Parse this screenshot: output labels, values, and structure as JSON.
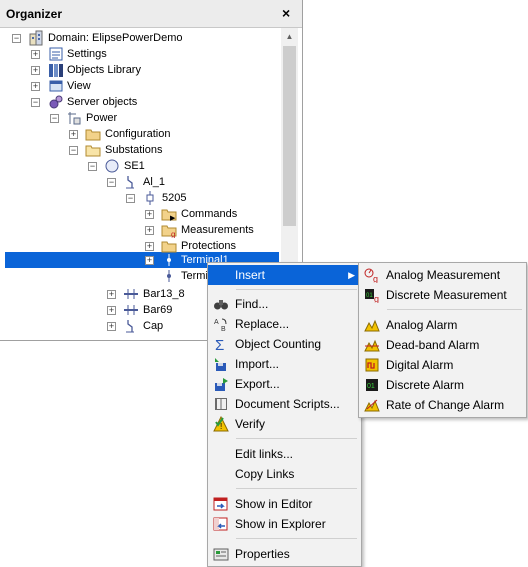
{
  "organizer": {
    "title": "Organizer",
    "close": "×",
    "scroll_up": "▲"
  },
  "tree": {
    "domain": "Domain: ElipsePowerDemo",
    "settings": "Settings",
    "objects_library": "Objects Library",
    "view": "View",
    "server_objects": "Server objects",
    "power": "Power",
    "configuration": "Configuration",
    "substations": "Substations",
    "se1": "SE1",
    "al1": "Al_1",
    "n5205": "5205",
    "commands": "Commands",
    "measurements": "Measurements",
    "protections": "Protections",
    "terminal1": "Terminal1",
    "terminal_partial": "Termi",
    "bar13": "Bar13_8",
    "bar69": "Bar69",
    "cap": "Cap"
  },
  "menu": {
    "insert": "Insert",
    "find": "Find...",
    "replace": "Replace...",
    "object_counting": "Object Counting",
    "import": "Import...",
    "export": "Export...",
    "document_scripts": "Document Scripts...",
    "verify": "Verify",
    "edit_links": "Edit links...",
    "copy_links": "Copy Links",
    "show_in_editor": "Show in Editor",
    "show_in_explorer": "Show in Explorer",
    "properties": "Properties",
    "submenu_arrow": "▶"
  },
  "submenu": {
    "analog_measurement": "Analog Measurement",
    "discrete_measurement": "Discrete Measurement",
    "analog_alarm": "Analog Alarm",
    "deadband_alarm": "Dead-band Alarm",
    "digital_alarm": "Digital Alarm",
    "discrete_alarm": "Discrete Alarm",
    "rate_of_change_alarm": "Rate of Change Alarm"
  },
  "colors": {
    "selection": "#0a64d8",
    "menu_bg": "#f2f2f2"
  }
}
